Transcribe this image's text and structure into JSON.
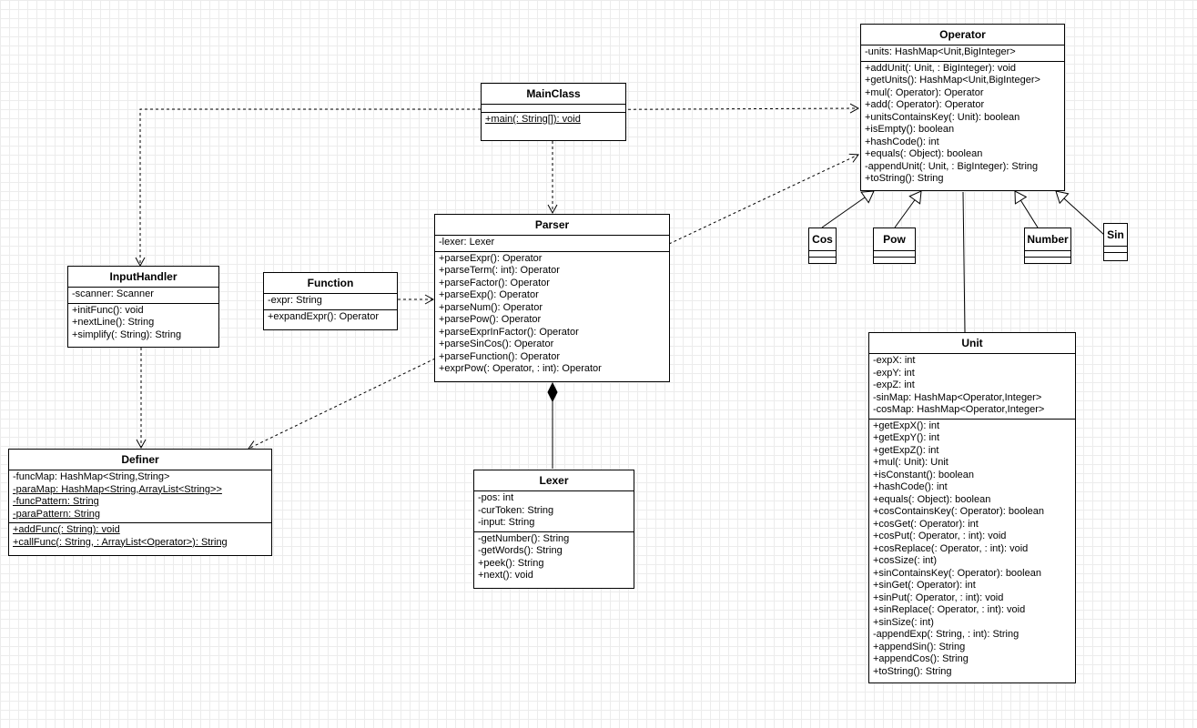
{
  "classes": {
    "operator": {
      "name": "Operator",
      "attributes": [
        "-units: HashMap<Unit,BigInteger>"
      ],
      "methods": [
        "+addUnit(: Unit, : BigInteger): void",
        "+getUnits(): HashMap<Unit,BigInteger>",
        "+mul(: Operator): Operator",
        "+add(: Operator): Operator",
        "+unitsContainsKey(: Unit): boolean",
        "+isEmpty(): boolean",
        "+hashCode(): int",
        "+equals(: Object): boolean",
        "-appendUnit(: Unit, : BigInteger): String",
        "+toString(): String"
      ]
    },
    "mainclass": {
      "name": "MainClass",
      "attributes": [],
      "methods": [
        "+main(: String[]): void"
      ]
    },
    "parser": {
      "name": "Parser",
      "attributes": [
        "-lexer: Lexer"
      ],
      "methods": [
        "+parseExpr(): Operator",
        "+parseTerm(: int): Operator",
        "+parseFactor(): Operator",
        "+parseExp(): Operator",
        "+parseNum(): Operator",
        "+parsePow(): Operator",
        "+parseExprInFactor(): Operator",
        "+parseSinCos(): Operator",
        "+parseFunction(): Operator",
        "+exprPow(: Operator, : int): Operator"
      ]
    },
    "inputhandler": {
      "name": "InputHandler",
      "attributes": [
        "-scanner: Scanner"
      ],
      "methods": [
        "+initFunc(): void",
        "+nextLine(): String",
        "+simplify(: String): String"
      ]
    },
    "function": {
      "name": "Function",
      "attributes": [
        "-expr: String"
      ],
      "methods": [
        "+expandExpr(): Operator"
      ]
    },
    "definer": {
      "name": "Definer",
      "attributes": [
        "-funcMap: HashMap<String,String>",
        "-paraMap: HashMap<String,ArrayList<String>>",
        "-funcPattern: String",
        "-paraPattern: String"
      ],
      "methods": [
        "+addFunc(: String): void",
        "+callFunc(: String, : ArrayList<Operator>): String"
      ]
    },
    "lexer": {
      "name": "Lexer",
      "attributes": [
        "-pos: int",
        "-curToken: String",
        "-input: String"
      ],
      "methods": [
        "-getNumber(): String",
        "-getWords(): String",
        "+peek(): String",
        "+next(): void"
      ]
    },
    "unit": {
      "name": "Unit",
      "attributes": [
        "-expX: int",
        "-expY: int",
        "-expZ: int",
        "-sinMap: HashMap<Operator,Integer>",
        "-cosMap: HashMap<Operator,Integer>"
      ],
      "methods": [
        "+getExpX(): int",
        "+getExpY(): int",
        "+getExpZ(): int",
        "+mul(: Unit): Unit",
        "+isConstant(): boolean",
        "+hashCode(): int",
        "+equals(: Object): boolean",
        "+cosContainsKey(: Operator): boolean",
        "+cosGet(: Operator): int",
        "+cosPut(: Operator, : int): void",
        "+cosReplace(: Operator, : int): void",
        "+cosSize(: int)",
        "+sinContainsKey(: Operator): boolean",
        "+sinGet(: Operator): int",
        "+sinPut(: Operator, : int): void",
        "+sinReplace(: Operator, : int): void",
        "+sinSize(: int)",
        "-appendExp(: String, : int): String",
        "+appendSin(): String",
        "+appendCos(): String",
        "+toString(): String"
      ]
    },
    "cos": {
      "name": "Cos"
    },
    "pow": {
      "name": "Pow"
    },
    "number": {
      "name": "Number"
    },
    "sin": {
      "name": "Sin"
    }
  },
  "relationships": [
    {
      "from": "MainClass",
      "to": "Operator",
      "type": "dependency"
    },
    {
      "from": "MainClass",
      "to": "InputHandler",
      "type": "dependency"
    },
    {
      "from": "MainClass",
      "to": "Parser",
      "type": "dependency"
    },
    {
      "from": "Parser",
      "to": "Operator",
      "type": "dependency"
    },
    {
      "from": "Parser",
      "to": "Definer",
      "type": "dependency"
    },
    {
      "from": "Function",
      "to": "Parser",
      "type": "dependency"
    },
    {
      "from": "InputHandler",
      "to": "Definer",
      "type": "dependency"
    },
    {
      "from": "Parser",
      "to": "Lexer",
      "type": "composition"
    },
    {
      "from": "Cos",
      "to": "Operator",
      "type": "generalization"
    },
    {
      "from": "Pow",
      "to": "Operator",
      "type": "generalization"
    },
    {
      "from": "Number",
      "to": "Operator",
      "type": "generalization"
    },
    {
      "from": "Sin",
      "to": "Operator",
      "type": "generalization"
    },
    {
      "from": "Operator",
      "to": "Unit",
      "type": "association"
    }
  ],
  "colors": {
    "line": "#000000",
    "box": "#ffffff",
    "grid": "#ececec"
  }
}
